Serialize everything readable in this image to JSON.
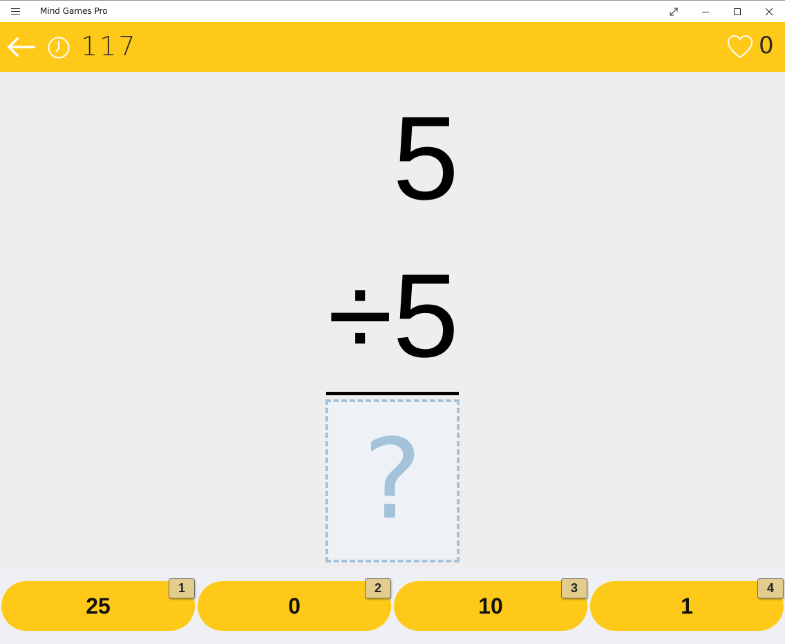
{
  "window": {
    "title": "Mind Games Pro",
    "icons": {
      "menu": "hamburger-icon",
      "maximize_fullscreen": "expand-icon",
      "minimize": "minimize-icon",
      "maximize": "maximize-icon",
      "close": "close-icon"
    }
  },
  "header": {
    "timer_value": "117",
    "score_value": "0",
    "icons": {
      "back": "back-arrow-icon",
      "timer": "clock-icon",
      "score": "heart-icon"
    },
    "background_color": "#fec918"
  },
  "problem": {
    "operand1": "5",
    "operand2": "÷5",
    "answer_placeholder": "?"
  },
  "answers": [
    {
      "label": "25",
      "key": "1"
    },
    {
      "label": "0",
      "key": "2"
    },
    {
      "label": "10",
      "key": "3"
    },
    {
      "label": "1",
      "key": "4"
    }
  ],
  "colors": {
    "accent": "#fec918",
    "answer_box_border": "#a6c2d8",
    "placeholder": "#a4c3da"
  }
}
